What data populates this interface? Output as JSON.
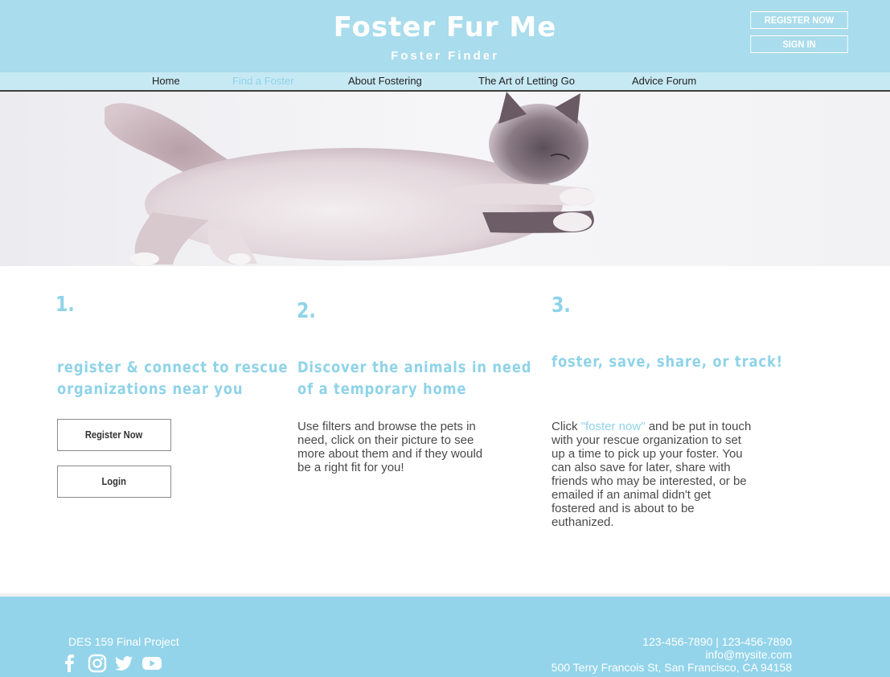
{
  "header": {
    "title": "Foster Fur Me",
    "subtitle": "Foster Finder",
    "register_label": "REGISTER NOW",
    "signin_label": "SIGN IN",
    "bg_color": "#a9dcec"
  },
  "nav": {
    "items": [
      {
        "label": "Home",
        "active": false
      },
      {
        "label": "Find a Foster",
        "active": true
      },
      {
        "label": "About Fostering",
        "active": false
      },
      {
        "label": "The Art of Letting Go",
        "active": false
      },
      {
        "label": "Advice Forum",
        "active": false
      }
    ],
    "accent": "#8fd3e8"
  },
  "hero": {
    "image": "cat-photo"
  },
  "steps": [
    {
      "number": "1.",
      "heading_line1": "register & connect to rescue",
      "heading_line2": "organizations near you"
    },
    {
      "number": "2.",
      "heading_line1": "Discover the animals in need",
      "heading_line2": "of a temporary home",
      "body": "Use filters and browse the pets in need, click on their picture to see more about them and if they would be a right fit for you!"
    },
    {
      "number": "3.",
      "heading_line1": "foster, save, share, or track!",
      "body_prefix": "Click ",
      "body_link": "\"foster now\"",
      "body_suffix": " and be put in touch with your rescue organization to set up a time to pick up your foster. You can also save for later, share with friends who may be interested, or be emailed if an animal didn't get fostered and is about to be euthanized."
    }
  ],
  "buttons": {
    "register": "Register Now",
    "login": "Login"
  },
  "footer": {
    "project": "DES 159 Final Project",
    "phones": "123-456-7890 | 123-456-7890",
    "email": "info@mysite.com",
    "address": "500 Terry Francois St, San Francisco, CA 94158",
    "social_icons": [
      "facebook-icon",
      "instagram-icon",
      "twitter-icon",
      "youtube-icon"
    ],
    "bg_color": "#93d4ea"
  }
}
